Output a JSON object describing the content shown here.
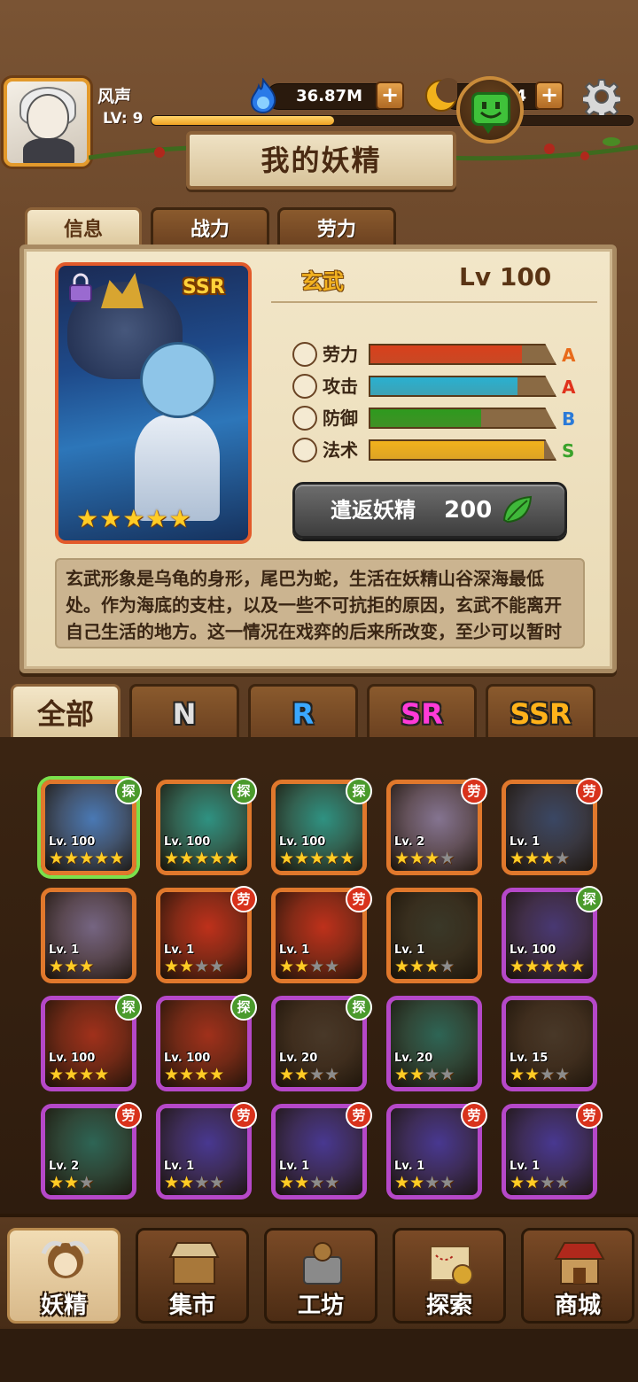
{
  "player": {
    "name": "风声",
    "level": "LV: 9",
    "xp_fraction": 0.38
  },
  "resources": {
    "spirit_gems": "36.87M",
    "moon_coins": "4"
  },
  "title": "我的妖精",
  "tabs": [
    "信息",
    "战力",
    "劳力"
  ],
  "spirit": {
    "name": "玄武",
    "level": "Lv 100",
    "rarity": "SSR",
    "stars": 5,
    "locked": true,
    "stats": [
      {
        "label": "劳力",
        "icon": "labor-icon",
        "value": 0.82,
        "grade": "A",
        "color": "#d8401c",
        "grade_color": "#e86a1a"
      },
      {
        "label": "攻击",
        "icon": "attack-icon",
        "value": 0.8,
        "grade": "A",
        "color": "#2ab0d0",
        "grade_color": "#e0321c"
      },
      {
        "label": "防御",
        "icon": "defense-icon",
        "value": 0.6,
        "grade": "B",
        "color": "#2e9a1e",
        "grade_color": "#2a7ad8"
      },
      {
        "label": "法术",
        "icon": "magic-icon",
        "value": 0.94,
        "grade": "S",
        "color": "#f2b21c",
        "grade_color": "#3aa22a"
      }
    ],
    "dismiss_label": "遣返妖精",
    "dismiss_cost": "200",
    "description": "玄武形象是乌龟的身形，尾巴为蛇，生活在妖精山谷深海最低处。作为海底的支柱，以及一些不可抗拒的原因，玄武不能离开自己生活的地方。这一情况在戏弈的后来所改变，至少可以暂时地上漂浮在"
  },
  "filters": [
    "全部",
    "N",
    "R",
    "SR",
    "SSR"
  ],
  "filter_colors": [
    "#4a2a12",
    "#e0e0e0",
    "#3aa8ff",
    "#ff3ad8",
    "#ffb21a"
  ],
  "grid": [
    {
      "lv": "Lv. 100",
      "stars": 5,
      "badge": "探",
      "frame": "orange",
      "tint": "#4b7fc0",
      "selected": true
    },
    {
      "lv": "Lv. 100",
      "stars": 5,
      "badge": "探",
      "frame": "orange",
      "tint": "#2e9a8a"
    },
    {
      "lv": "Lv. 100",
      "stars": 5,
      "badge": "探",
      "frame": "orange",
      "tint": "#2e9a8a"
    },
    {
      "lv": "Lv. 2",
      "stars": 3,
      "max": 4,
      "badge": "劳",
      "frame": "orange",
      "tint": "#8a7a9a"
    },
    {
      "lv": "Lv. 1",
      "stars": 3,
      "max": 4,
      "badge": "劳",
      "frame": "orange",
      "tint": "#3a4a6a"
    },
    {
      "lv": "Lv. 1",
      "stars": 3,
      "max": 3,
      "badge": "",
      "frame": "orange",
      "tint": "#7a6a8a"
    },
    {
      "lv": "Lv. 1",
      "stars": 2,
      "max": 4,
      "badge": "劳",
      "frame": "orange",
      "tint": "#c8321c"
    },
    {
      "lv": "Lv. 1",
      "stars": 2,
      "max": 4,
      "badge": "劳",
      "frame": "orange",
      "tint": "#c8321c"
    },
    {
      "lv": "Lv. 1",
      "stars": 3,
      "max": 4,
      "badge": "",
      "frame": "orange",
      "tint": "#3a3a2a"
    },
    {
      "lv": "Lv. 100",
      "stars": 5,
      "badge": "探",
      "frame": "purple",
      "tint": "#4a3a7a"
    },
    {
      "lv": "Lv. 100",
      "stars": 4,
      "badge": "探",
      "frame": "purple",
      "tint": "#a8321c"
    },
    {
      "lv": "Lv. 100",
      "stars": 4,
      "badge": "探",
      "frame": "purple",
      "tint": "#a8321c"
    },
    {
      "lv": "Lv. 20",
      "stars": 2,
      "max": 4,
      "badge": "探",
      "frame": "purple",
      "tint": "#4a3a2a"
    },
    {
      "lv": "Lv. 20",
      "stars": 2,
      "max": 4,
      "badge": "",
      "frame": "purple",
      "tint": "#2e6a5a"
    },
    {
      "lv": "Lv. 15",
      "stars": 2,
      "max": 4,
      "badge": "",
      "frame": "purple",
      "tint": "#4a3a2a"
    },
    {
      "lv": "Lv. 2",
      "stars": 2,
      "max": 3,
      "badge": "劳",
      "frame": "purple",
      "tint": "#2e6a5a"
    },
    {
      "lv": "Lv. 1",
      "stars": 2,
      "max": 4,
      "badge": "劳",
      "frame": "purple",
      "tint": "#4a3a9a"
    },
    {
      "lv": "Lv. 1",
      "stars": 2,
      "max": 4,
      "badge": "劳",
      "frame": "purple",
      "tint": "#4a3a9a"
    },
    {
      "lv": "Lv. 1",
      "stars": 2,
      "max": 4,
      "badge": "劳",
      "frame": "purple",
      "tint": "#4a3a9a"
    },
    {
      "lv": "Lv. 1",
      "stars": 2,
      "max": 4,
      "badge": "劳",
      "frame": "purple",
      "tint": "#4a3a9a"
    }
  ],
  "nav": [
    {
      "label": "妖精",
      "icon": "spirit-icon",
      "active": true
    },
    {
      "label": "集市",
      "icon": "market-icon",
      "active": false
    },
    {
      "label": "工坊",
      "icon": "workshop-icon",
      "active": false
    },
    {
      "label": "探索",
      "icon": "explore-map-icon",
      "active": false
    },
    {
      "label": "商城",
      "icon": "shop-icon",
      "active": false
    }
  ]
}
